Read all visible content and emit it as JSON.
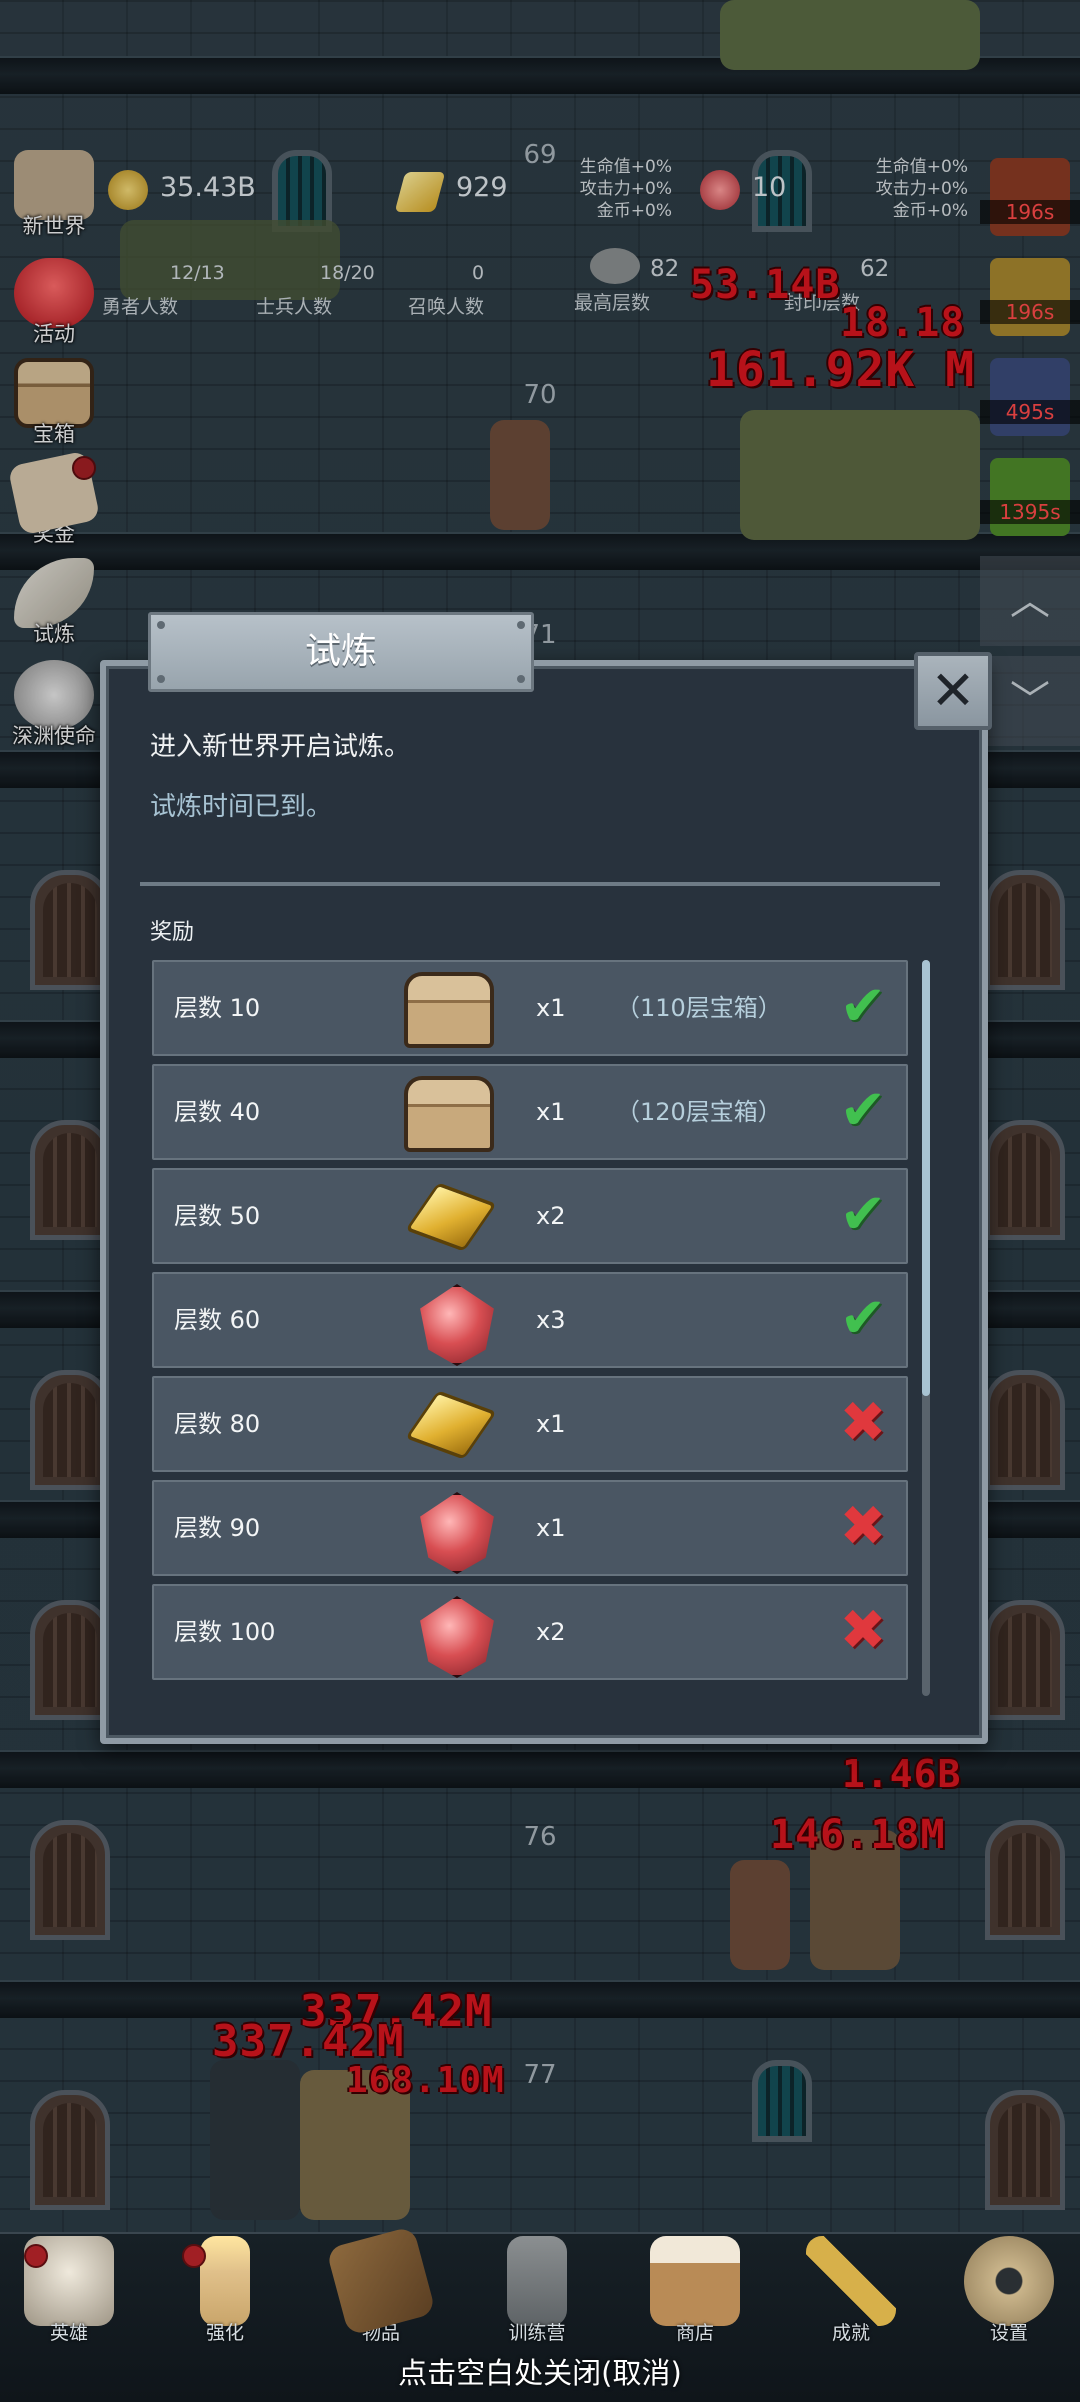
{
  "top_stats": {
    "gold": "35.43B",
    "gold_bars": "929",
    "gems": "10",
    "floor_top": "69",
    "hero_count": "12/13",
    "hero_label": "勇者人数",
    "soldier_count": "18/20",
    "soldier_label": "士兵人数",
    "summon_count": "0",
    "summon_label": "召唤人数",
    "max_floor": "82",
    "max_floor_label": "最高层数",
    "seal_floor": "62",
    "seal_floor_label": "封印层数",
    "bonus_left": [
      "生命值+0%",
      "攻击力+0%",
      "金币+0%"
    ],
    "bonus_right": [
      "生命值+0%",
      "攻击力+0%",
      "金币+0%"
    ]
  },
  "left_menu": [
    {
      "label": "新世界",
      "icon": "new-world-icon"
    },
    {
      "label": "活动",
      "icon": "heart-icon"
    },
    {
      "label": "宝箱",
      "icon": "chest-icon"
    },
    {
      "label": "奖金",
      "icon": "envelope-icon"
    },
    {
      "label": "试炼",
      "icon": "feather-icon"
    },
    {
      "label": "深渊使命",
      "icon": "orb-icon"
    }
  ],
  "right_timers": [
    "196s",
    "196s",
    "495s",
    "1395s"
  ],
  "floors": {
    "f70": "70",
    "f71": "71",
    "f76": "76",
    "f77": "77"
  },
  "damage": {
    "d1": "53.14B",
    "d2": "18.18",
    "d3": "161.92K M",
    "d4": "1.46B",
    "d5": "146.18M",
    "d6": "337.42M",
    "d7": "337.42M",
    "d8": "168.10M"
  },
  "dialog": {
    "title": "试炼",
    "close_icon": "close-icon",
    "description": "进入新世界开启试炼。",
    "status": "试炼时间已到。",
    "reward_label": "奖励",
    "rewards": [
      {
        "level": "层数 10",
        "item": "chest",
        "qty": "x1",
        "note": "（110层宝箱）",
        "done": true
      },
      {
        "level": "层数 40",
        "item": "chest",
        "qty": "x1",
        "note": "（120层宝箱）",
        "done": true
      },
      {
        "level": "层数 50",
        "item": "gold-bar",
        "qty": "x2",
        "note": "",
        "done": true
      },
      {
        "level": "层数 60",
        "item": "gem",
        "qty": "x3",
        "note": "",
        "done": true
      },
      {
        "level": "层数 80",
        "item": "gold-bar",
        "qty": "x1",
        "note": "",
        "done": false
      },
      {
        "level": "层数 90",
        "item": "gem",
        "qty": "x1",
        "note": "",
        "done": false
      },
      {
        "level": "层数 100",
        "item": "gem",
        "qty": "x2",
        "note": "",
        "done": false
      }
    ]
  },
  "bottom_nav": [
    {
      "label": "英雄",
      "icon": "skull-icon"
    },
    {
      "label": "强化",
      "icon": "candle-icon"
    },
    {
      "label": "物品",
      "icon": "book-icon"
    },
    {
      "label": "训练营",
      "icon": "lantern-icon"
    },
    {
      "label": "商店",
      "icon": "mug-icon"
    },
    {
      "label": "成就",
      "icon": "key-icon"
    },
    {
      "label": "设置",
      "icon": "gear-icon"
    }
  ],
  "close_hint": "点击空白处关闭(取消)"
}
